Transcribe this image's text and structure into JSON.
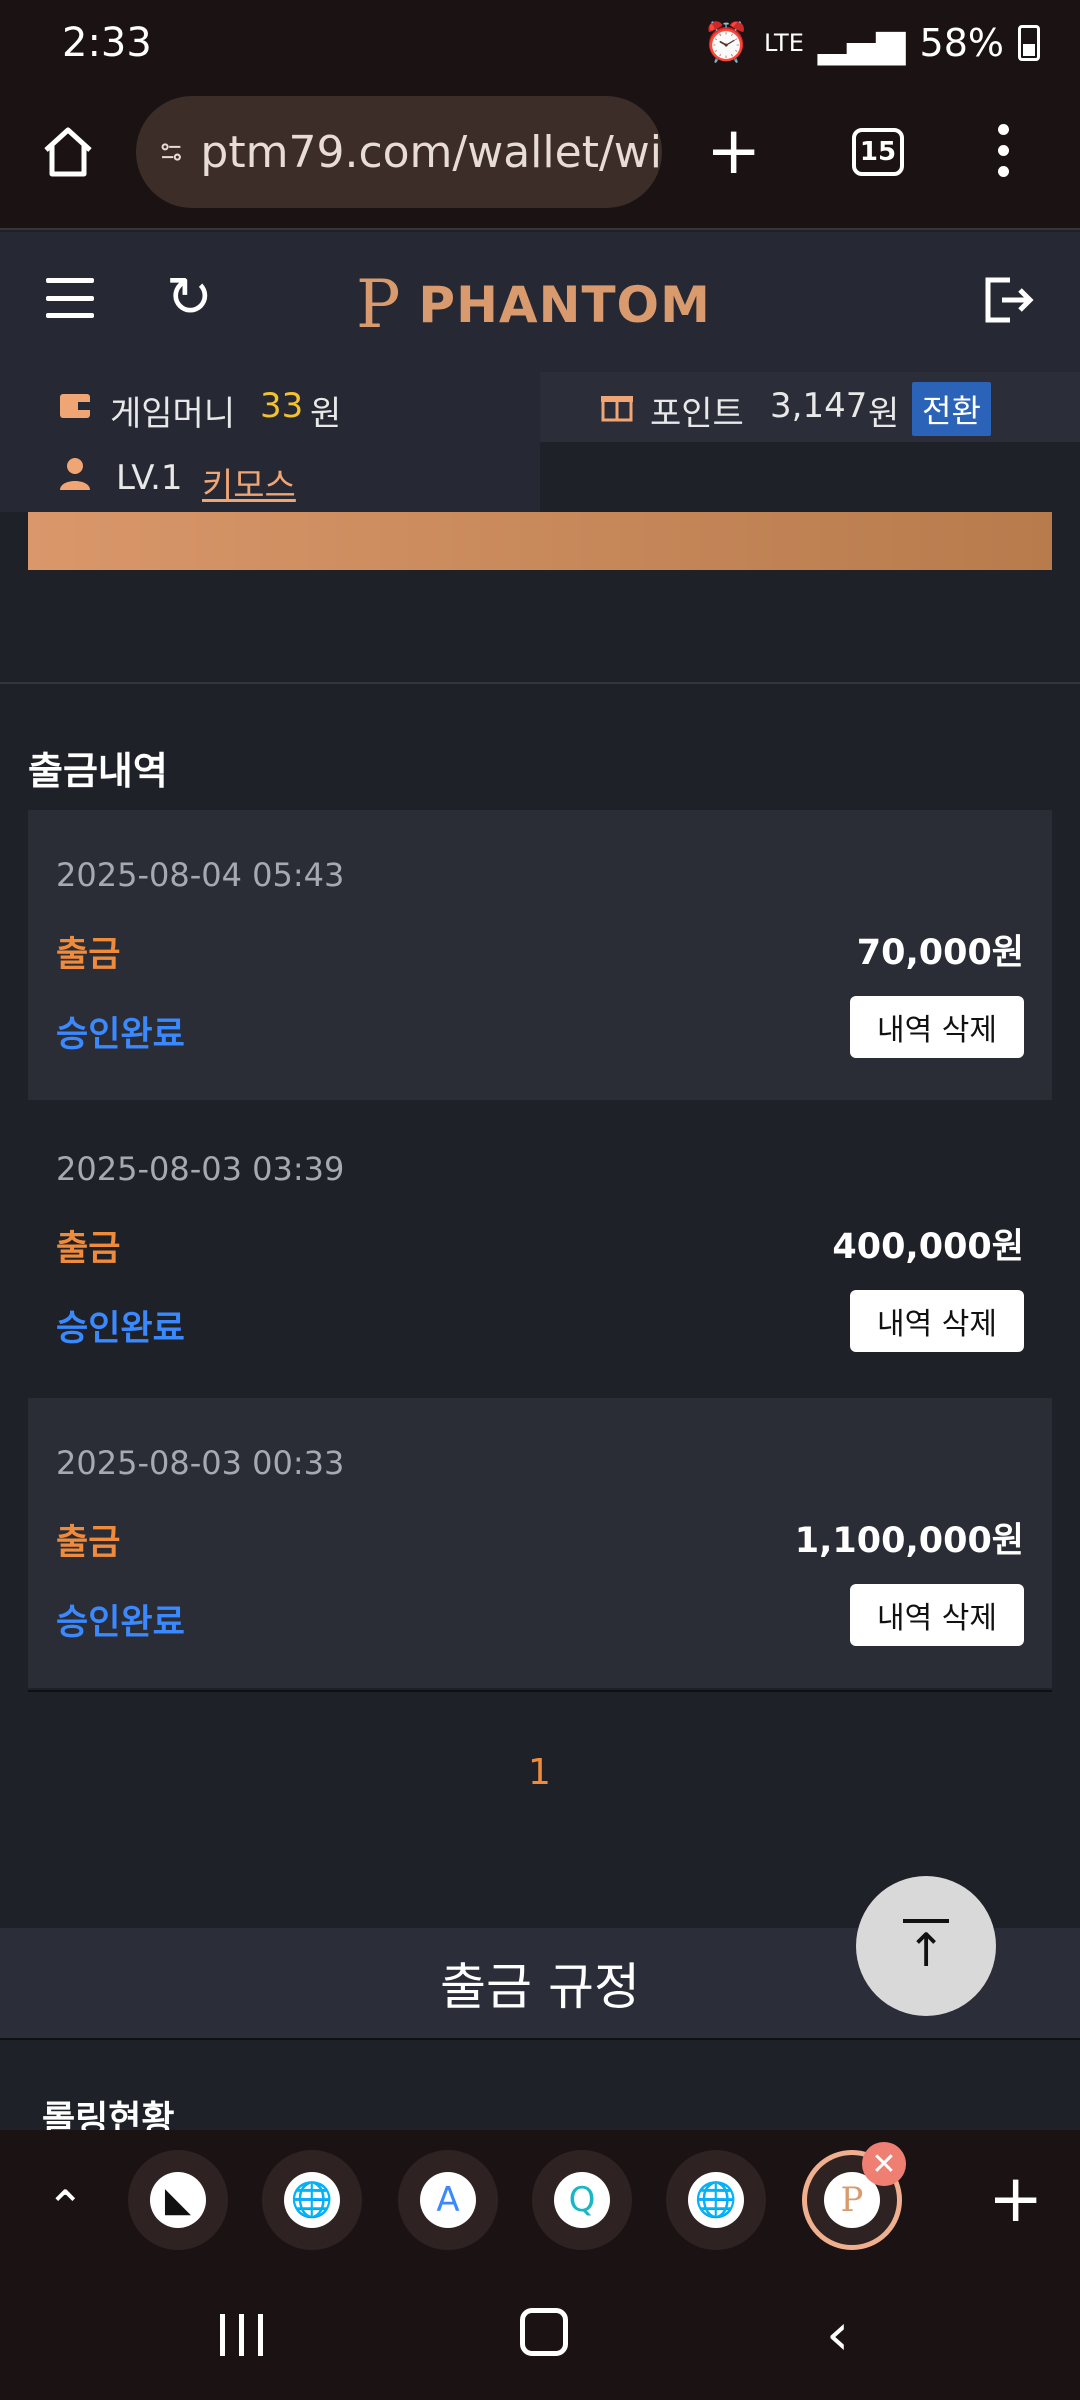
{
  "status_bar": {
    "time": "2:33",
    "battery": "58%",
    "signal_text": "LTE"
  },
  "browser": {
    "url": "ptm79.com/wallet/wi",
    "tab_count": "15"
  },
  "site": {
    "logo_text": "PHANTOM",
    "logo_mark": "P"
  },
  "wallet": {
    "game_money_label": "게임머니",
    "game_money_value": "33",
    "currency": "원",
    "points_label": "포인트",
    "points_value": "3,147",
    "convert_label": "전환",
    "level": "LV.1",
    "username": "키모스"
  },
  "section": {
    "title": "출금내역"
  },
  "withdrawals": [
    {
      "date": "2025-08-04 05:43",
      "type": "출금",
      "amount": "70,000원",
      "status": "승인완료",
      "delete_label": "내역 삭제"
    },
    {
      "date": "2025-08-03 03:39",
      "type": "출금",
      "amount": "400,000원",
      "status": "승인완료",
      "delete_label": "내역 삭제"
    },
    {
      "date": "2025-08-03 00:33",
      "type": "출금",
      "amount": "1,100,000원",
      "status": "승인완료",
      "delete_label": "내역 삭제"
    }
  ],
  "pagination": {
    "current": "1"
  },
  "rules": {
    "title": "출금 규정"
  },
  "rolling": {
    "title": "롤링현황"
  },
  "colors": {
    "accent_orange": "#f08b3b",
    "status_blue": "#3a89ff",
    "logo_gold": "#d99b6d"
  }
}
